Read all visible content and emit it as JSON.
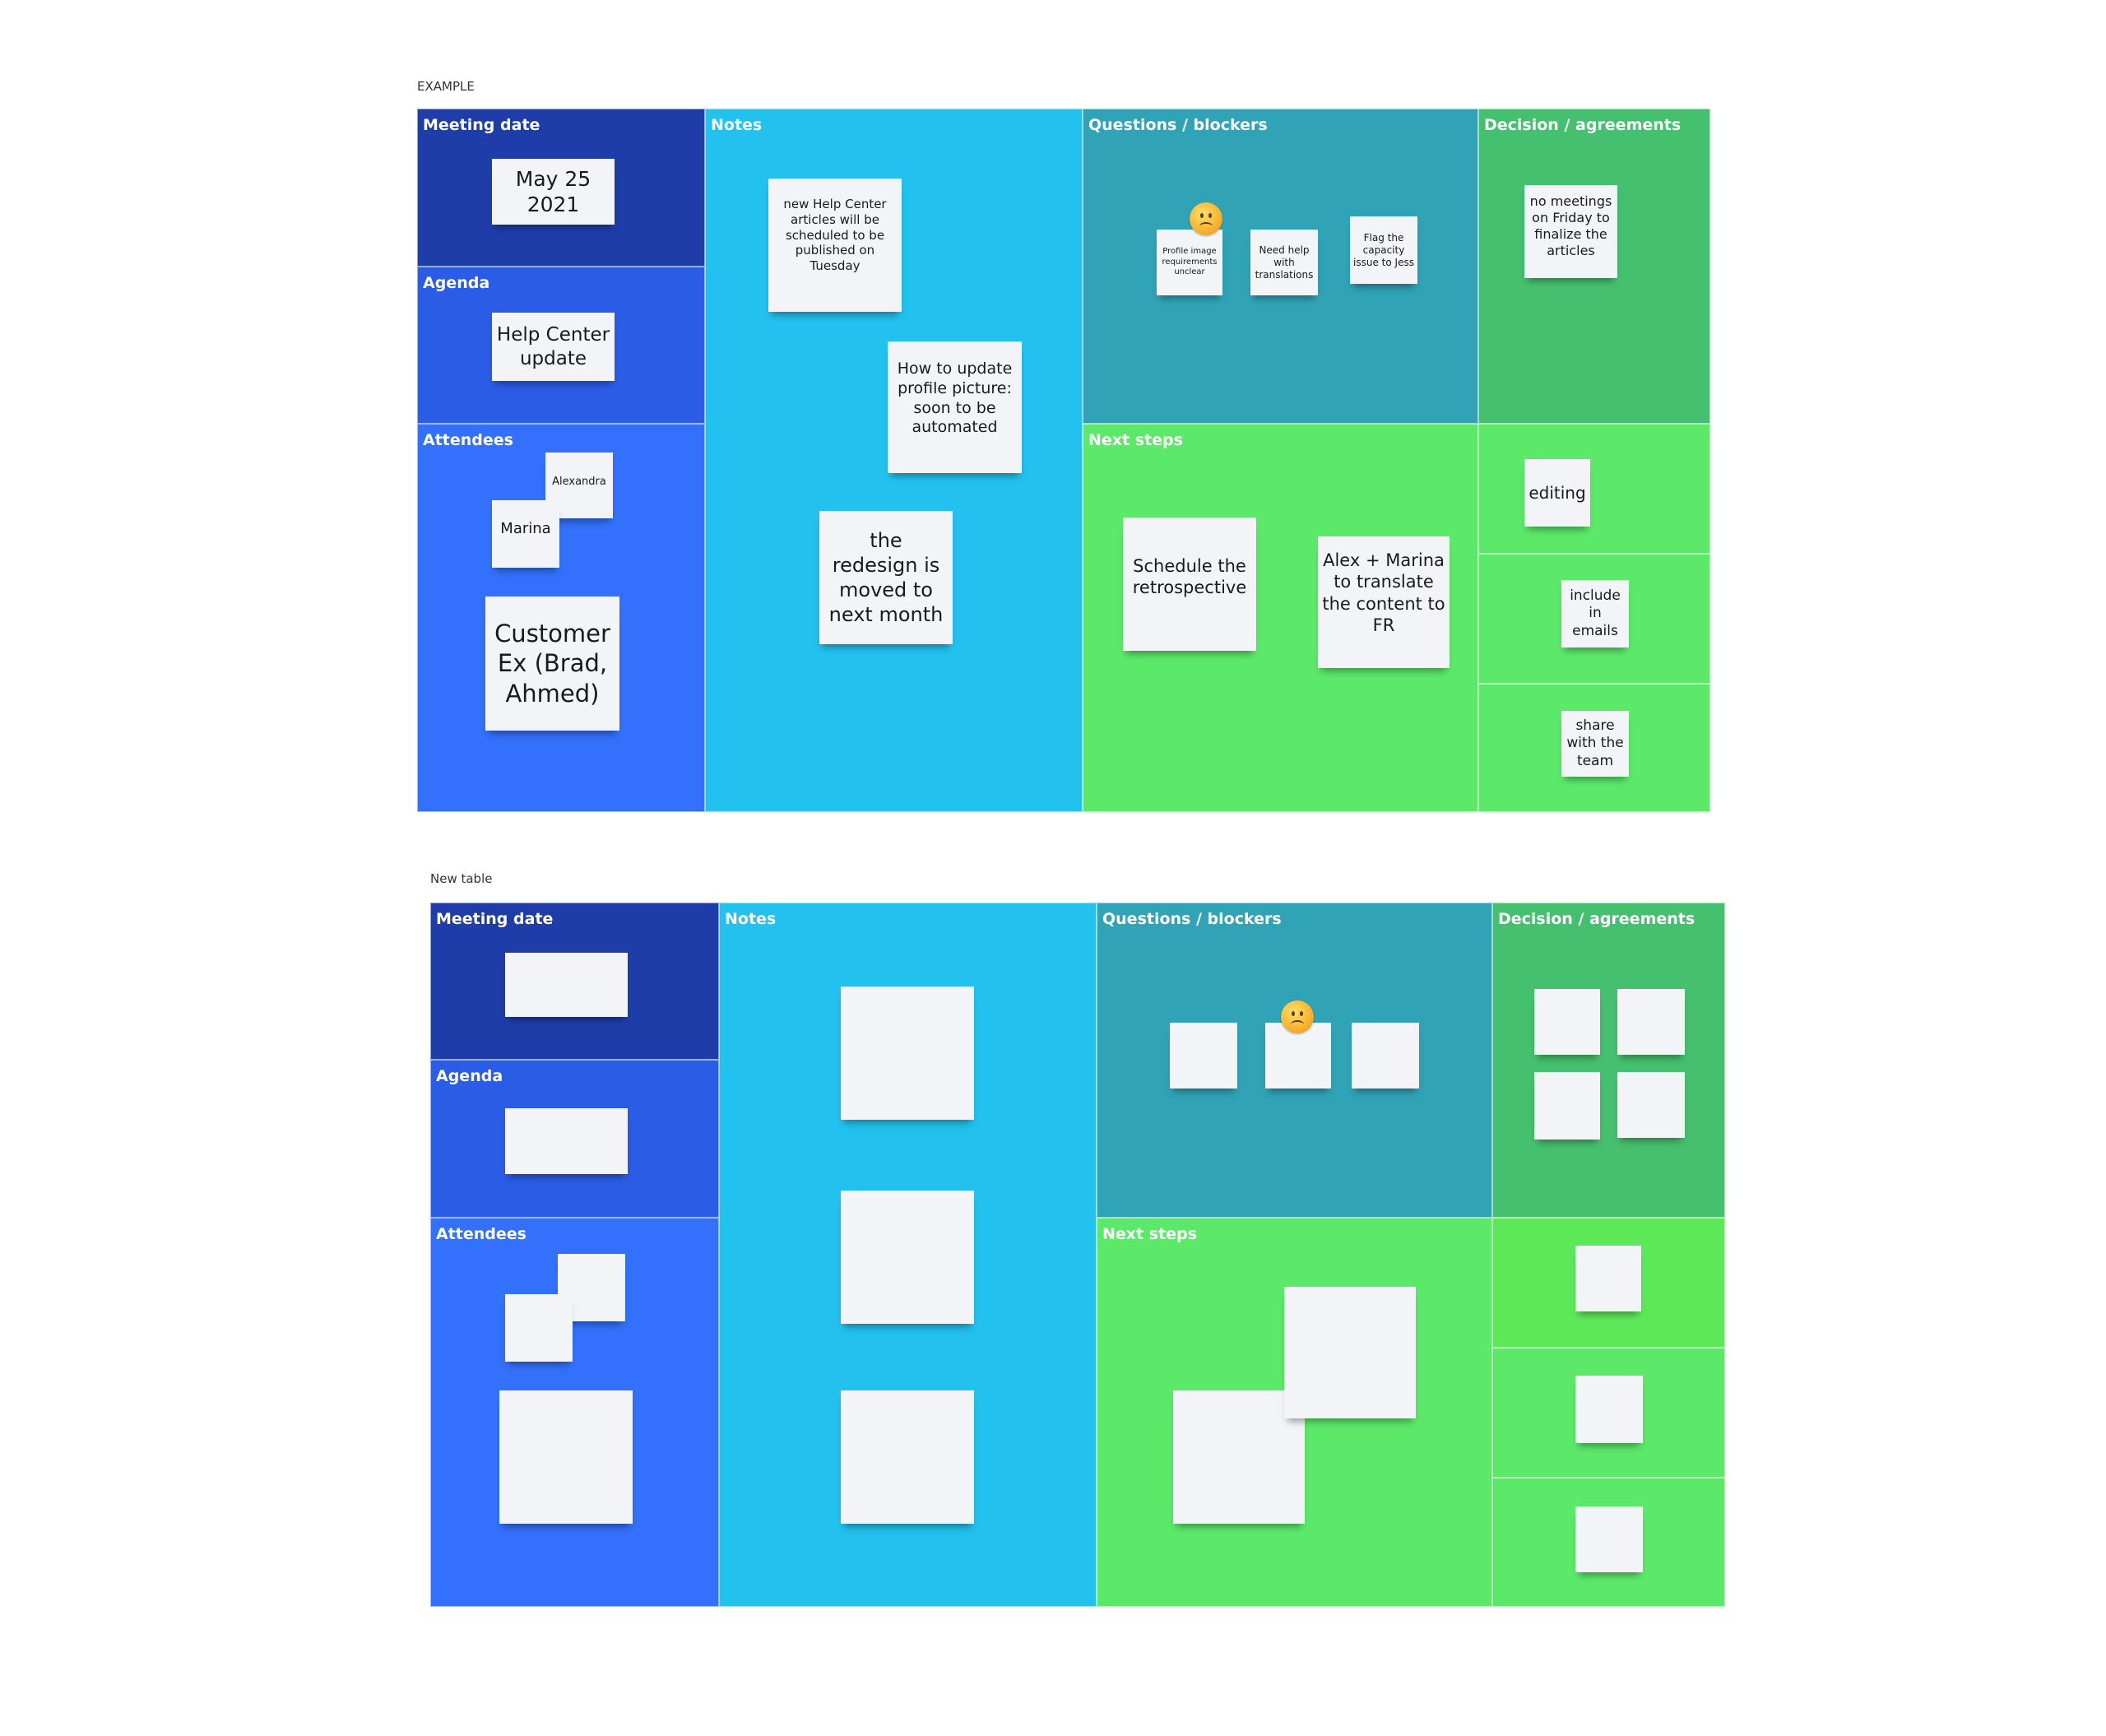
{
  "boards": [
    {
      "label": "EXAMPLE",
      "cells": {
        "meeting_date": "Meeting date",
        "agenda": "Agenda",
        "attendees": "Attendees",
        "notes": "Notes",
        "questions": "Questions / blockers",
        "next_steps": "Next steps",
        "decision": "Decision / agreements"
      },
      "stickies": {
        "date": "May 25 2021",
        "agenda": "Help Center update",
        "attendee_1": "Alexandra",
        "attendee_2": "Marina",
        "attendee_3": "Customer Ex (Brad, Ahmed)",
        "note_1": "new Help Center articles will be scheduled to be published on Tuesday",
        "note_2": "How to update profile picture: soon to be automated",
        "note_3": "the redesign is moved to next month",
        "question_1": "Profile image requirements unclear",
        "question_2": "Need help with translations",
        "question_3": "Flag the capacity issue to Jess",
        "decision_1": "no meetings on Friday to finalize the articles",
        "next_1": "Schedule the retrospective",
        "next_2": "Alex + Marina to translate the content to FR",
        "sub_1": "editing",
        "sub_2": "include in emails",
        "sub_3": "share with the team"
      },
      "reaction": "confused-face-emoji"
    },
    {
      "label": "New table",
      "cells": {
        "meeting_date": "Meeting date",
        "agenda": "Agenda",
        "attendees": "Attendees",
        "notes": "Notes",
        "questions": "Questions / blockers",
        "next_steps": "Next steps",
        "decision": "Decision / agreements"
      },
      "reaction": "confused-face-emoji"
    }
  ],
  "colors": {
    "meeting_date": "#1e3da8",
    "agenda": "#2b5ce6",
    "attendees": "#3370fb",
    "notes": "#22c1ee",
    "questions": "#30a3b7",
    "decision": "#45c06e",
    "next_steps": "#5ce96a",
    "decision_sub_bright": "#5de85a",
    "sticky": "#f2f4f7"
  }
}
